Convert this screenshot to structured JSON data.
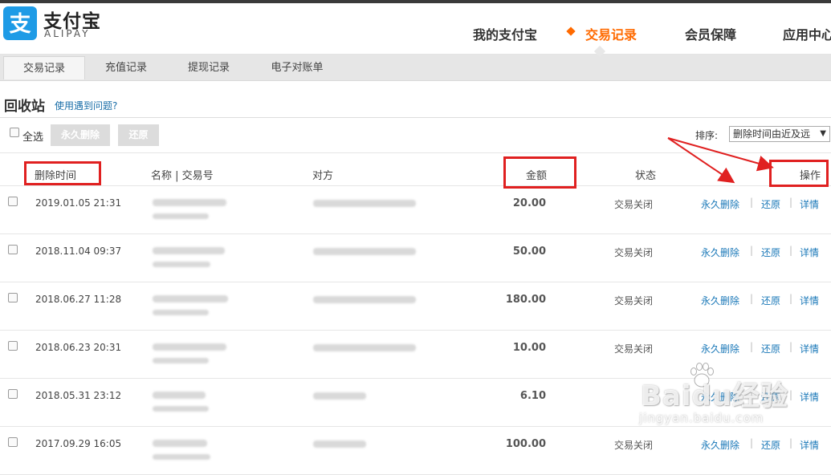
{
  "header": {
    "logo_cn": "支付宝",
    "logo_en": "ALIPAY",
    "nav": [
      "我的支付宝",
      "交易记录",
      "会员保障",
      "应用中心"
    ],
    "active_nav": "交易记录"
  },
  "subnav": {
    "tabs": [
      "交易记录",
      "充值记录",
      "提现记录",
      "电子对账单"
    ],
    "active": "交易记录"
  },
  "page": {
    "title": "回收站",
    "help_link": "使用遇到问题?"
  },
  "toolbar": {
    "select_all": "全选",
    "delete_button": "永久删除",
    "restore_button": "还原",
    "sort_label": "排序:",
    "sort_value": "删除时间由近及远",
    "sort_arrow": "▼"
  },
  "table": {
    "headers": {
      "delete_time": "删除时间",
      "name_no": "名称 | 交易号",
      "counterparty": "对方",
      "amount": "金额",
      "status": "状态",
      "action": "操作"
    },
    "action_labels": {
      "delete": "永久删除",
      "restore": "还原",
      "detail": "详情",
      "sep": "|"
    },
    "rows": [
      {
        "date": "2019.01.05 21:31",
        "amount": "20.00",
        "status": "交易关闭"
      },
      {
        "date": "2018.11.04 09:37",
        "amount": "50.00",
        "status": "交易关闭"
      },
      {
        "date": "2018.06.27 11:28",
        "amount": "180.00",
        "status": "交易关闭"
      },
      {
        "date": "2018.06.23 20:31",
        "amount": "10.00",
        "status": "交易关闭"
      },
      {
        "date": "2018.05.31 23:12",
        "amount": "6.10",
        "status": ""
      },
      {
        "date": "2017.09.29 16:05",
        "amount": "100.00",
        "status": "交易关闭"
      }
    ]
  },
  "watermark": {
    "brand": "Baidu经验",
    "url": "jingyan.baidu.com"
  },
  "colors": {
    "accent": "#ff6a00",
    "link": "#1a78b8",
    "annotation_red": "#e02020",
    "logo_blue": "#1e9be6"
  }
}
